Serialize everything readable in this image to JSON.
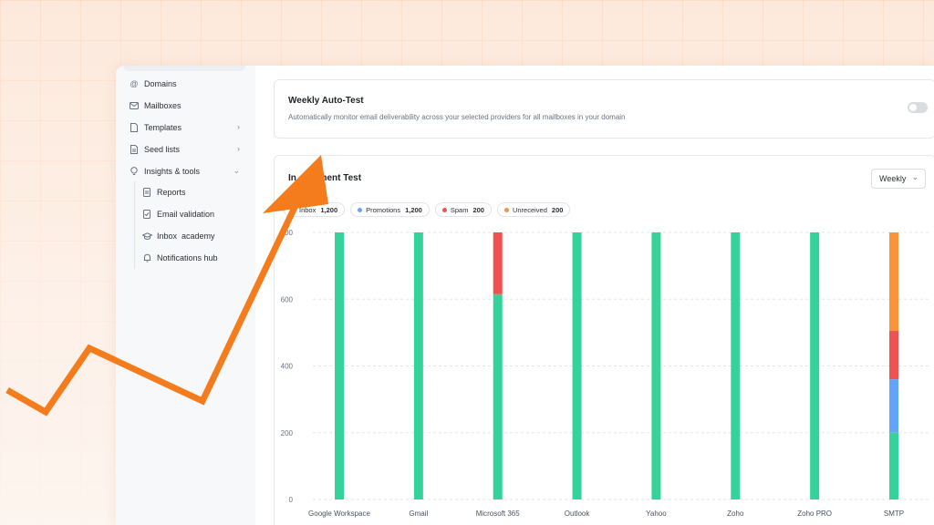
{
  "sidebar": {
    "items": [
      {
        "label": "Domains",
        "icon": "at-icon"
      },
      {
        "label": "Mailboxes",
        "icon": "mail-icon"
      },
      {
        "label": "Templates",
        "icon": "file-icon"
      },
      {
        "label": "Seed lists",
        "icon": "list-icon"
      },
      {
        "label": "Insights & tools",
        "icon": "lightbulb-icon"
      }
    ],
    "subitems": [
      {
        "label": "Reports",
        "icon": "report-icon"
      },
      {
        "label": "Email validation",
        "icon": "check-doc-icon"
      },
      {
        "label": "Inbox  academy",
        "icon": "graduation-cap-icon"
      },
      {
        "label": "Notifications hub",
        "icon": "bell-icon"
      }
    ]
  },
  "auto_test": {
    "title": "Weekly Auto-Test",
    "description": "Automatically monitor email deliverability across your selected providers for all mailboxes in your domain",
    "enabled": false
  },
  "chart_card": {
    "title": "In    acement Test",
    "period": "Weekly"
  },
  "legend": [
    {
      "label": "Inbox",
      "value": "1,200",
      "color": "#34d399"
    },
    {
      "label": "Promotions",
      "value": "1,200",
      "color": "#60a5fa"
    },
    {
      "label": "Spam",
      "value": "200",
      "color": "#f05252"
    },
    {
      "label": "Unreceived",
      "value": "200",
      "color": "#fb923c"
    }
  ],
  "chart_data": {
    "type": "bar",
    "stacked": true,
    "categories": [
      "Google Workspace",
      "Gmail",
      "Microsoft 365",
      "Outlook",
      "Yahoo",
      "Zoho",
      "Zoho PRO",
      "SMTP"
    ],
    "series": [
      {
        "name": "Inbox",
        "color": "#34d399",
        "values": [
          800,
          800,
          615,
          800,
          800,
          800,
          800,
          200
        ]
      },
      {
        "name": "Promotions",
        "color": "#60a5fa",
        "values": [
          0,
          0,
          0,
          0,
          0,
          0,
          0,
          160
        ]
      },
      {
        "name": "Spam",
        "color": "#f05252",
        "values": [
          0,
          0,
          185,
          0,
          0,
          0,
          0,
          145
        ]
      },
      {
        "name": "Unreceived",
        "color": "#fb923c",
        "values": [
          0,
          0,
          0,
          0,
          0,
          0,
          0,
          295
        ]
      }
    ],
    "yticks": [
      0,
      200,
      400,
      600,
      800
    ],
    "ylim": [
      0,
      800
    ],
    "grid": true
  }
}
